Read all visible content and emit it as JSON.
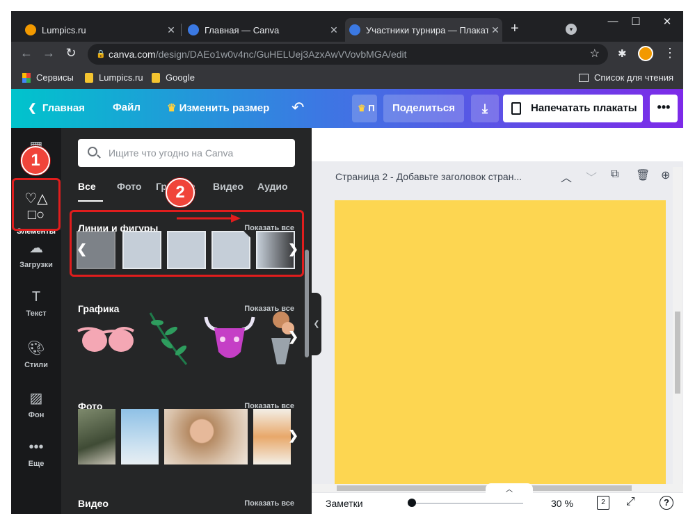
{
  "browser": {
    "tabs": [
      {
        "title": "Lumpics.ru",
        "color": "#f29900"
      },
      {
        "title": "Главная — Canva",
        "color": "#3b79e3"
      },
      {
        "title": "Участники турнира — Плакат",
        "color": "#3b79e3"
      }
    ],
    "window_controls": {
      "minimize": "—",
      "maximize": "☐",
      "close": "✕"
    },
    "url_host": "canva.com",
    "url_path": "/design/DAEo1w0v4nc/GuHELUej3AzxAwVVovbMGA/edit",
    "bookmarks": [
      "Сервисы",
      "Lumpics.ru",
      "Google"
    ],
    "reading_list": "Список для чтения"
  },
  "header": {
    "home": "Главная",
    "file": "Файл",
    "resize": "Изменить размер",
    "pro_label": "П",
    "share": "Поделиться",
    "print": "Напечатать плакаты",
    "more": "•••"
  },
  "rail": [
    {
      "label": "",
      "icon": "template-icon"
    },
    {
      "label": "Элементы",
      "icon": "shapes-icon"
    },
    {
      "label": "Загрузки",
      "icon": "cloud-upload-icon"
    },
    {
      "label": "Текст",
      "icon": "text-icon"
    },
    {
      "label": "Стили",
      "icon": "palette-icon"
    },
    {
      "label": "Фон",
      "icon": "background-icon"
    },
    {
      "label": "Еще",
      "icon": "more-icon"
    }
  ],
  "panel": {
    "search_placeholder": "Ищите что угодно на Canva",
    "categories": [
      "Все",
      "Фото",
      "Графика",
      "Видео",
      "Аудио"
    ],
    "categories_visible": [
      "Все",
      "Фото",
      "Гр",
      "ка",
      "Видео",
      "Аудио"
    ],
    "sections": [
      {
        "title": "Линии и фигуры",
        "link": "Показать все"
      },
      {
        "title": "Графика",
        "link": "Показать все"
      },
      {
        "title": "Фото",
        "link": "Показать все"
      },
      {
        "title": "Видео",
        "link": "Показать все"
      }
    ]
  },
  "canvas": {
    "page_title": "Страница 2 - Добавьте заголовок стран...",
    "page_color": "#fdd651",
    "notes": "Заметки",
    "zoom": "30 %",
    "page_count": "2",
    "help": "?"
  },
  "annotations": [
    "1",
    "2"
  ],
  "colors": {
    "accent_red": "#e01d1d",
    "header_start": "#00c4cc",
    "header_end": "#7d2ae8"
  }
}
